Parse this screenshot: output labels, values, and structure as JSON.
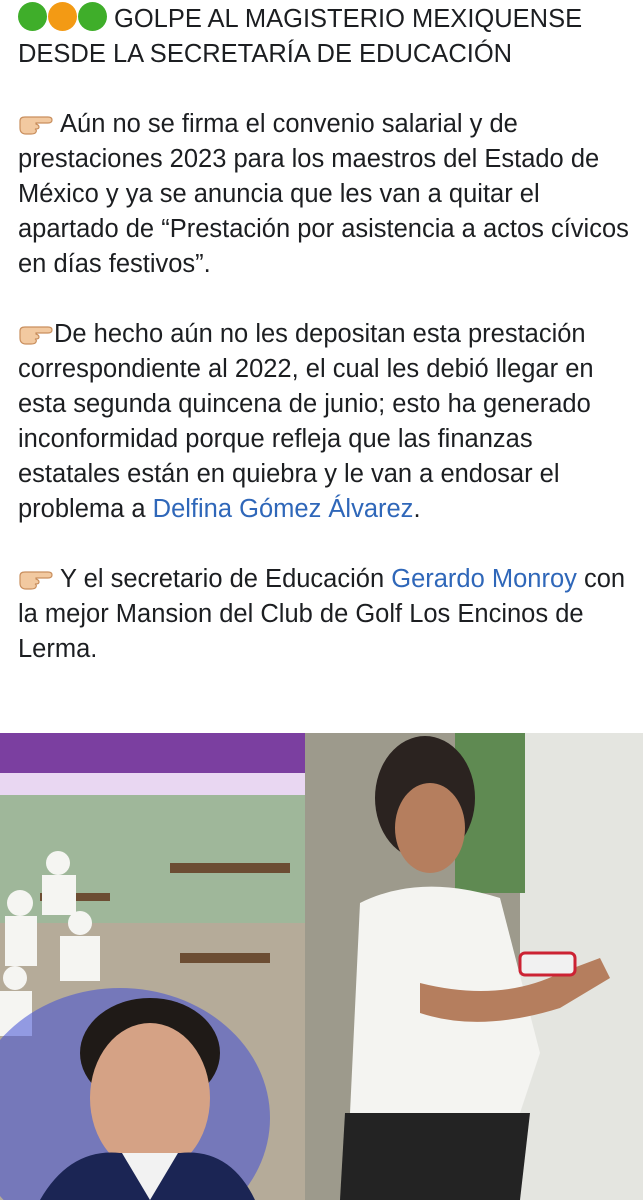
{
  "post": {
    "status_dots": {
      "colors": [
        "#3fae2a",
        "#f39a14",
        "#3fae2a"
      ]
    },
    "title_line1": "GOLPE AL MAGISTERIO MEXIQUENSE",
    "title_line2": "DESDE LA SECRETARÍA DE EDUCACIÓN",
    "paragraph1": "Aún no se firma el convenio salarial y de prestaciones 2023 para los maestros del Estado de México y ya se anuncia que les van a quitar el apartado de “Prestación por asistencia a actos cívicos en días festivos”.",
    "paragraph2": "De hecho aún no les depositan esta prestación correspondiente al 2022, el cual les debió llegar en esta segunda quincena de junio; esto ha generado inconformidad porque refleja que las finanzas estatales están en quiebra y le van a endosar el problema a ",
    "paragraph2_link": "Delfina Gómez Álvarez",
    "paragraph2_end": ".",
    "paragraph3_start": "Y el secretario de Educación ",
    "paragraph3_link": "Gerardo Monroy",
    "paragraph3_end": " con la mejor Mansion del Club de Golf Los Encinos de Lerma.",
    "link_color": "#2f67b9",
    "icons": [
      "green-circle-icon",
      "orange-circle-icon",
      "green-circle-icon",
      "pointing-hand-icon"
    ]
  }
}
